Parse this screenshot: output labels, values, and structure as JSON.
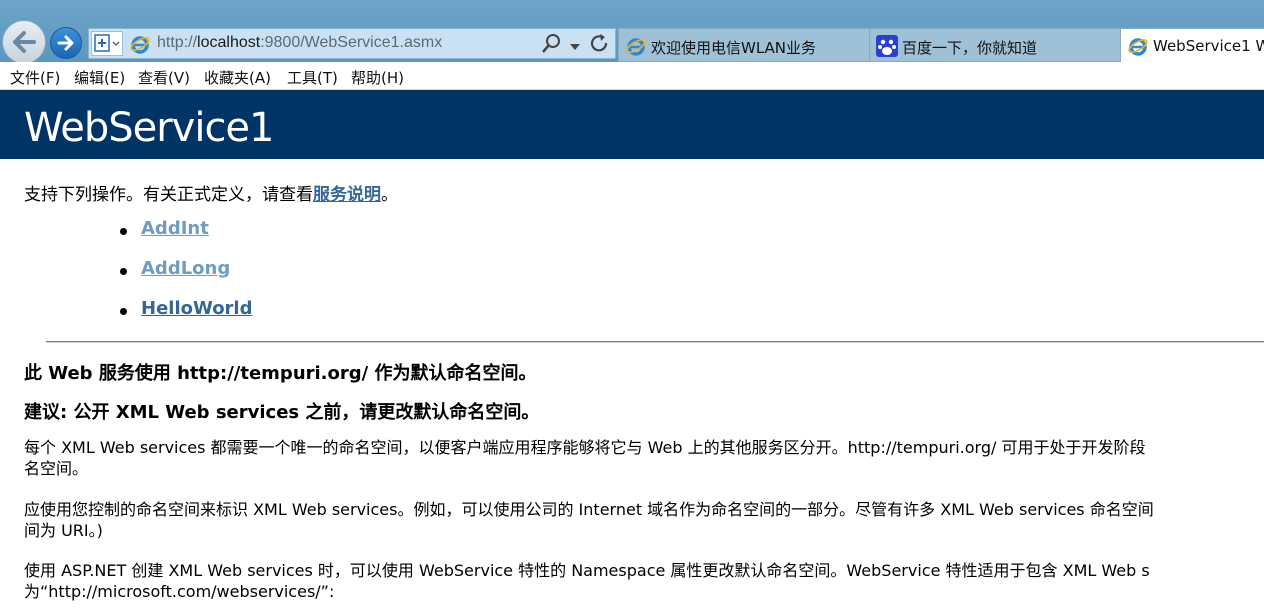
{
  "browser": {
    "url_prefix": "http://",
    "url_host": "localhost",
    "url_rest": ":9800/WebService1.asmx",
    "tabs": [
      {
        "label": "欢迎使用电信WLAN业务",
        "icon": "ie-icon"
      },
      {
        "label": "百度一下，你就知道",
        "icon": "baidu-paw-icon"
      },
      {
        "label": "WebService1 W",
        "icon": "ie-icon"
      }
    ]
  },
  "menu": [
    "文件(F)",
    "编辑(E)",
    "查看(V)",
    "收藏夹(A)",
    "工具(T)",
    "帮助(H)"
  ],
  "page": {
    "title": "WebService1",
    "intro_text": "支持下列操作。有关正式定义，请查看",
    "intro_link": "服务说明",
    "intro_end": "。",
    "operations": [
      "AddInt",
      "AddLong",
      "HelloWorld"
    ],
    "heading1": "此 Web 服务使用 http://tempuri.org/ 作为默认命名空间。",
    "heading2": "建议: 公开 XML Web services 之前，请更改默认命名空间。",
    "para1_line1": "每个 XML Web services 都需要一个唯一的命名空间，以便客户端应用程序能够将它与 Web 上的其他服务区分开。http://tempuri.org/ 可用于处于开发阶段",
    "para1_line2": "名空间。",
    "para2_line1": "应使用您控制的命名空间来标识 XML Web services。例如，可以使用公司的 Internet 域名作为命名空间的一部分。尽管有许多 XML Web services 命名空间",
    "para2_line2": "间为 URI。)",
    "para3_line1": "使用 ASP.NET 创建 XML Web services 时，可以使用 WebService 特性的 Namespace 属性更改默认命名空间。WebService 特性适用于包含 XML Web s",
    "para3_line2": "为“http://microsoft.com/webservices/”:"
  },
  "colors": {
    "banner": "#003366",
    "link": "#336699",
    "visited_link": "#6d9cc4"
  }
}
